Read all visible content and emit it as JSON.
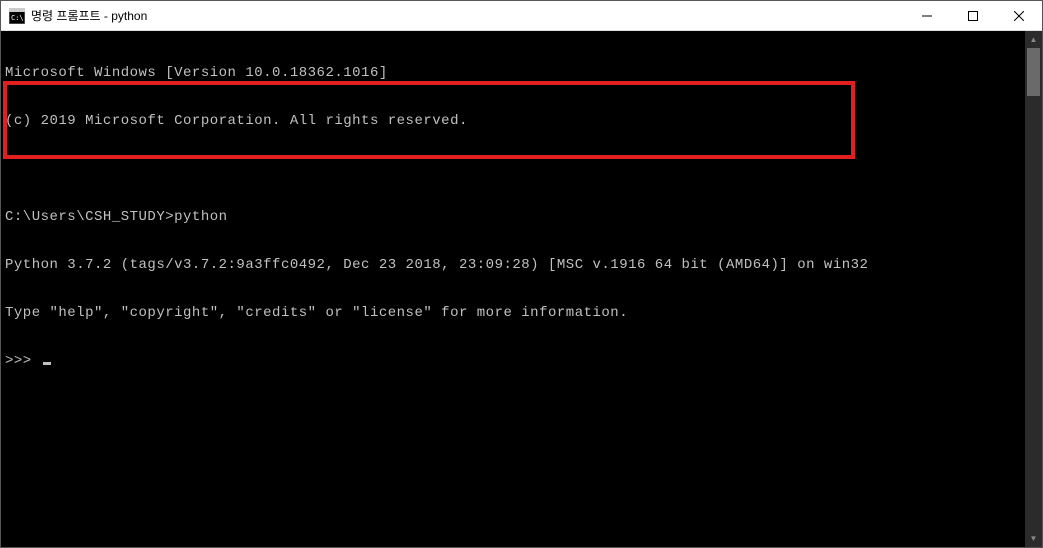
{
  "window": {
    "title": "명령 프롬프트 - python"
  },
  "terminal": {
    "lines": [
      "Microsoft Windows [Version 10.0.18362.1016]",
      "(c) 2019 Microsoft Corporation. All rights reserved.",
      "",
      "C:\\Users\\CSH_STUDY>python",
      "Python 3.7.2 (tags/v3.7.2:9a3ffc0492, Dec 23 2018, 23:09:28) [MSC v.1916 64 bit (AMD64)] on win32",
      "Type \"help\", \"copyright\", \"credits\" or \"license\" for more information.",
      ">>> "
    ]
  }
}
